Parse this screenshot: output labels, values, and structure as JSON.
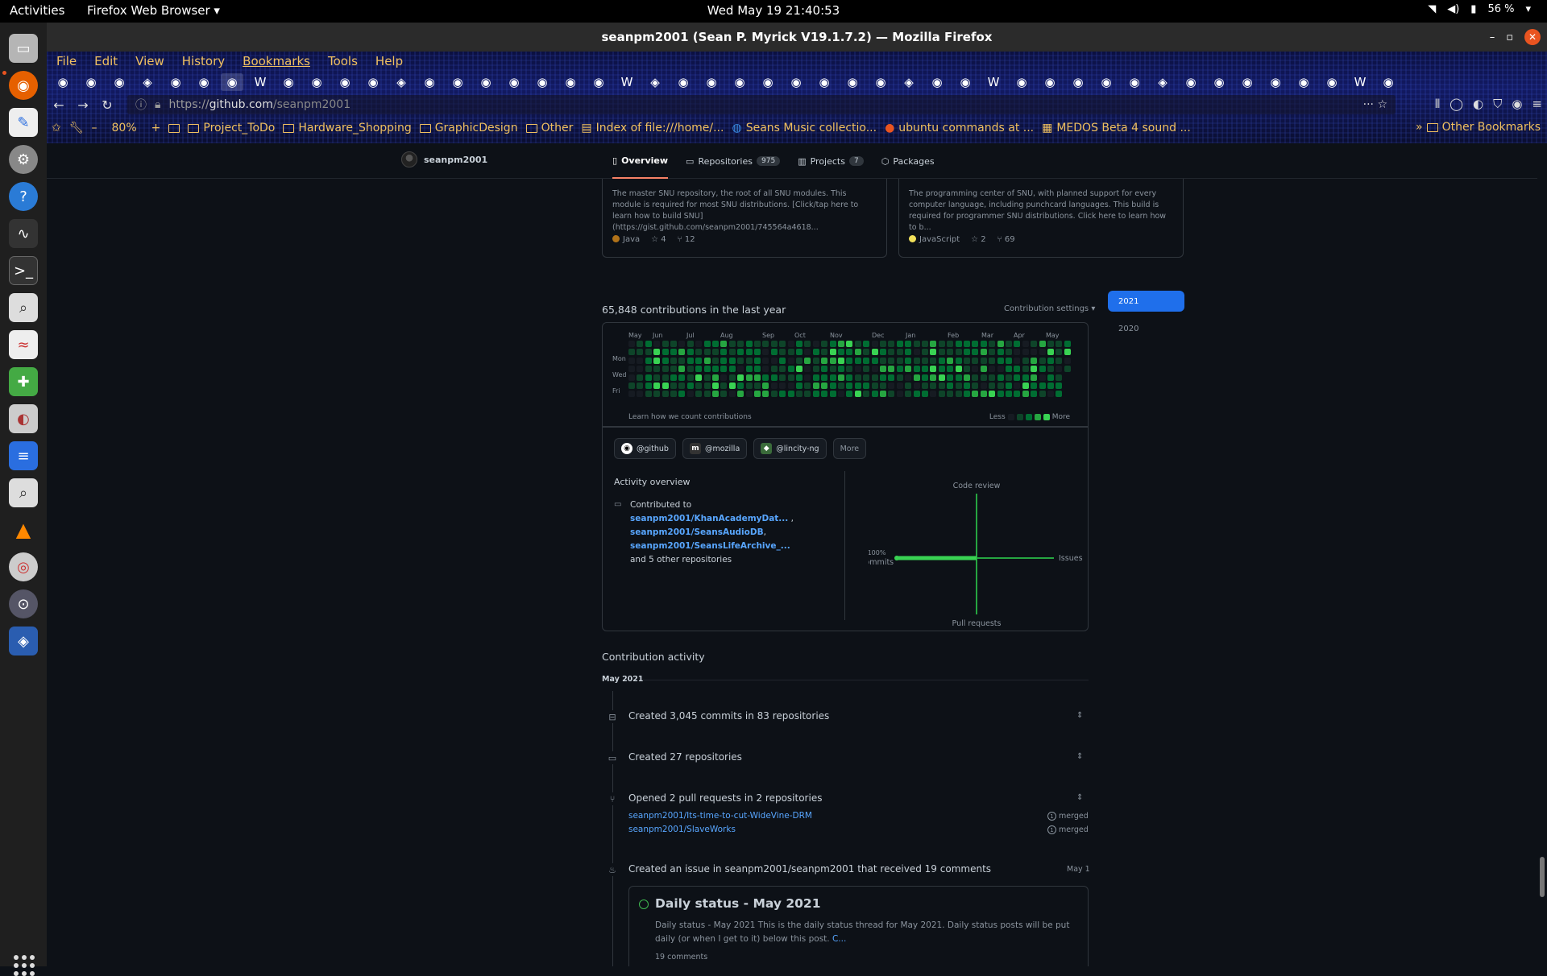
{
  "topbar": {
    "activities": "Activities",
    "app": "Firefox Web Browser ▾",
    "clock": "Wed May 19  21:40:53",
    "battery": "56 %"
  },
  "window": {
    "title": "seanpm2001 (Sean P. Myrick V19.1.7.2) — Mozilla Firefox"
  },
  "menu": {
    "items": [
      "File",
      "Edit",
      "View",
      "History",
      "Bookmarks",
      "Tools",
      "Help"
    ]
  },
  "url": {
    "scheme": "https://",
    "host": "github.com",
    "path": "/seanpm2001"
  },
  "bookmarks": {
    "zoom": "80%",
    "items": [
      "Project_ToDo",
      "Hardware_Shopping",
      "GraphicDesign",
      "Other",
      "Index of file:///home/...",
      "Seans Music collectio...",
      "ubuntu commands at ...",
      "MEDOS Beta 4 sound ..."
    ],
    "other": "Other Bookmarks"
  },
  "profile": {
    "username": "seanpm2001",
    "tabs": [
      {
        "label": "Overview",
        "count": ""
      },
      {
        "label": "Repositories",
        "count": "975"
      },
      {
        "label": "Projects",
        "count": "7"
      },
      {
        "label": "Packages",
        "count": ""
      }
    ]
  },
  "pins": [
    {
      "desc": "The master SNU repository, the root of all SNU modules. This module is required for most SNU distributions. [Click/tap here to learn how to build SNU](https://gist.github.com/seanpm2001/745564a4618...",
      "lang": "Java",
      "lang_color": "#b07219",
      "stars": "4",
      "forks": "12"
    },
    {
      "desc": "The programming center of SNU, with planned support for every computer language, including punchcard languages. This build is required for programmer SNU distributions. Click here to learn how to b...",
      "lang": "JavaScript",
      "lang_color": "#f1e05a",
      "stars": "2",
      "forks": "69"
    }
  ],
  "contributions": {
    "title": "65,848 contributions in the last year",
    "settings": "Contribution settings ▾",
    "months": [
      "May",
      "Jun",
      "Jul",
      "Aug",
      "Sep",
      "Oct",
      "Nov",
      "Dec",
      "Jan",
      "Feb",
      "Mar",
      "Apr",
      "May"
    ],
    "days": [
      "Mon",
      "Wed",
      "Fri"
    ],
    "learn": "Learn how we count contributions",
    "less": "Less",
    "more": "More"
  },
  "orgs": [
    {
      "label": "@github",
      "icon": "github-icon"
    },
    {
      "label": "@mozilla",
      "icon": "mozilla-icon"
    },
    {
      "label": "@lincity-ng",
      "icon": "lincity-icon"
    }
  ],
  "orgs_more": "More",
  "activity": {
    "title": "Activity overview",
    "contributed_to": "Contributed to",
    "repos": [
      "seanpm2001/KhanAcademyDat...",
      "seanpm2001/SeansAudioDB",
      "seanpm2001/SeansLifeArchive_..."
    ],
    "others": "and 5 other repositories",
    "axes": {
      "top": "Code review",
      "right": "Issues",
      "bottom": "Pull requests",
      "left_pct": "100%",
      "left": "Commits"
    }
  },
  "years": [
    "2021",
    "2020"
  ],
  "contribution_activity": {
    "title": "Contribution activity",
    "month": "May 2021",
    "events": [
      "Created 3,045 commits in 83 repositories",
      "Created 27 repositories",
      "Opened 2 pull requests in 2 repositories",
      "Created an issue in seanpm2001/seanpm2001 that received 19 comments"
    ],
    "prs": [
      {
        "repo": "seanpm2001/Its-time-to-cut-WideVine-DRM",
        "state": "merged",
        "num": "1"
      },
      {
        "repo": "seanpm2001/SlaveWorks",
        "state": "merged",
        "num": "1"
      }
    ],
    "issue_date": "May 1",
    "issue": {
      "title": "Daily status - May 2021",
      "body": "Daily status - May 2021 This is the daily status thread for May 2021. Daily status posts will be put daily (or when I get to it) below this post.",
      "body_link": "C...",
      "comments": "19 comments"
    }
  },
  "colors": {
    "accent": "#1f6feb",
    "green_levels": [
      "#161b22",
      "#0e4429",
      "#006d32",
      "#26a641",
      "#39d353"
    ]
  }
}
